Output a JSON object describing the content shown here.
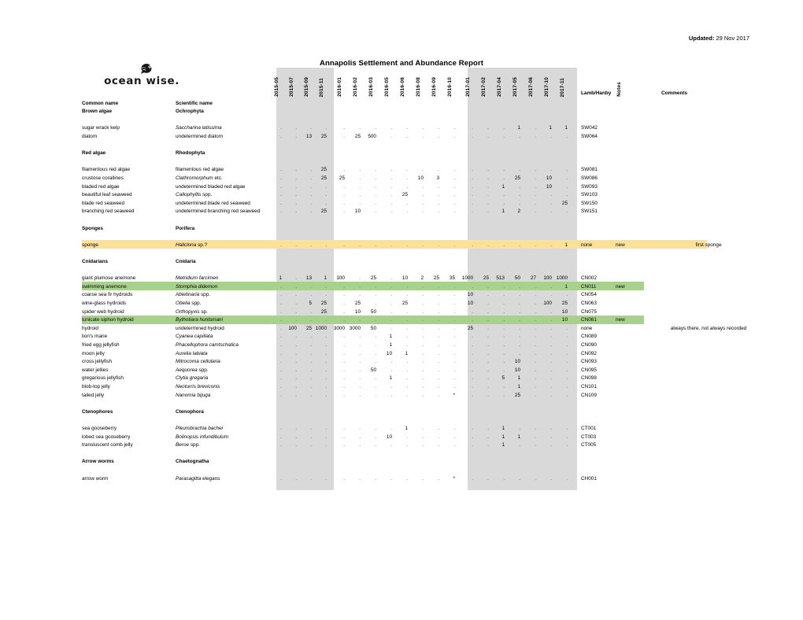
{
  "meta": {
    "updated_label": "Updated:",
    "updated_value": "29 Nov 2017",
    "title": "Annapolis Settlement and Abundance Report",
    "logo_text": "ocean wise.",
    "logo_icon": "orca-globe-icon"
  },
  "columns": {
    "common_name_header": "Common name",
    "scientific_name_header": "Scientific name",
    "periods": [
      "2015-05",
      "2015-07",
      "2015-09",
      "2015-11",
      "2016-01",
      "2016-02",
      "2016-03",
      "2016-05",
      "2016-06",
      "2016-08",
      "2016-09",
      "2016-10",
      "2017-01",
      "2017-02",
      "2017-04",
      "2017-05",
      "2017-06",
      "2017-10",
      "2017-11"
    ],
    "lamb_hanby_header": "Lamb/Hanby",
    "notes_header": "Notes",
    "comments_header": "Comments"
  },
  "colors": {
    "band_gray": "#d9d9d9",
    "highlight_yellow": "#fce197",
    "highlight_green": "#a9d18e",
    "text": "#000000"
  },
  "rows": [
    {
      "type": "group",
      "common": "Brown algae",
      "sci": "Ochrophyta",
      "sci_italic": false,
      "values": [],
      "code": "",
      "note": "",
      "comment": ""
    },
    {
      "type": "spacer"
    },
    {
      "type": "data",
      "common": "sugar wrack kelp",
      "sci": "Saccharina latissima",
      "sci_italic": true,
      "values": [
        ".",
        ".",
        ".",
        ".",
        ".",
        ".",
        ".",
        ".",
        ".",
        ".",
        ".",
        ".",
        ".",
        ".",
        ".",
        "1",
        ".",
        "1",
        "1"
      ],
      "code": "SW042",
      "note": "",
      "comment": ""
    },
    {
      "type": "data",
      "common": "diatom",
      "sci": "undetermined diatom",
      "sci_italic": false,
      "values": [
        ".",
        ".",
        "13",
        "25",
        ".",
        "25",
        "500",
        ".",
        ".",
        ".",
        ".",
        ".",
        ".",
        ".",
        ".",
        ".",
        ".",
        ".",
        "."
      ],
      "code": "SW064",
      "note": "",
      "comment": ""
    },
    {
      "type": "spacer"
    },
    {
      "type": "group",
      "common": "Red algae",
      "sci": "Rhodophyta",
      "sci_italic": false,
      "values": [],
      "code": "",
      "note": "",
      "comment": ""
    },
    {
      "type": "spacer"
    },
    {
      "type": "data",
      "common": "filamentous red algae",
      "sci": "filamentous red algae",
      "sci_italic": false,
      "values": [
        ".",
        ".",
        ".",
        "25",
        ".",
        ".",
        ".",
        ".",
        ".",
        ".",
        ".",
        ".",
        ".",
        ".",
        ".",
        ".",
        ".",
        ".",
        "."
      ],
      "code": "SW081",
      "note": "",
      "comment": ""
    },
    {
      "type": "data",
      "common": "crustose corallines",
      "sci": "Clathromorphum etc.",
      "sci_italic": true,
      "values": [
        ".",
        ".",
        ".",
        "25",
        "25",
        ".",
        ".",
        ".",
        ".",
        "10",
        "3",
        ".",
        ".",
        ".",
        ".",
        "25",
        ".",
        "10",
        "."
      ],
      "code": "SW086",
      "note": "",
      "comment": ""
    },
    {
      "type": "data",
      "common": "bladed red algae",
      "sci": "undetermined bladed red algae",
      "sci_italic": false,
      "values": [
        ".",
        ".",
        ".",
        ".",
        ".",
        ".",
        ".",
        ".",
        ".",
        ".",
        ".",
        ".",
        ".",
        ".",
        "1",
        ".",
        ".",
        "10",
        "."
      ],
      "code": "SW093",
      "note": "",
      "comment": ""
    },
    {
      "type": "data",
      "common": "beautiful leaf seaweed",
      "sci": "Callophyllis spp.",
      "sci_italic": true,
      "values": [
        ".",
        ".",
        ".",
        ".",
        ".",
        ".",
        ".",
        ".",
        "25",
        ".",
        ".",
        ".",
        ".",
        ".",
        ".",
        ".",
        ".",
        ".",
        "."
      ],
      "code": "SW103",
      "note": "",
      "comment": ""
    },
    {
      "type": "data",
      "common": "blade red seaweed",
      "sci": "undetermined blade red seaweed",
      "sci_italic": false,
      "values": [
        ".",
        ".",
        ".",
        ".",
        ".",
        ".",
        ".",
        ".",
        ".",
        ".",
        ".",
        ".",
        ".",
        ".",
        ".",
        ".",
        ".",
        ".",
        "25"
      ],
      "code": "SW150",
      "note": "",
      "comment": ""
    },
    {
      "type": "data",
      "common": "branching red seaweed",
      "sci": "undetermined branching red seaweed",
      "sci_italic": false,
      "values": [
        ".",
        ".",
        ".",
        "25",
        ".",
        "10",
        ".",
        ".",
        ".",
        ".",
        ".",
        ".",
        ".",
        ".",
        "1",
        "2",
        ".",
        ".",
        "."
      ],
      "code": "SW151",
      "note": "",
      "comment": ""
    },
    {
      "type": "spacer"
    },
    {
      "type": "group",
      "common": "Sponges",
      "sci": "Porifera",
      "sci_italic": false,
      "values": [],
      "code": "",
      "note": "",
      "comment": ""
    },
    {
      "type": "spacer"
    },
    {
      "type": "data",
      "common": "sponge",
      "sci": "Haliclona sp.?",
      "sci_italic": true,
      "values": [
        ".",
        ".",
        ".",
        ".",
        ".",
        ".",
        ".",
        ".",
        ".",
        ".",
        ".",
        ".",
        ".",
        ".",
        ".",
        ".",
        ".",
        ".",
        "1"
      ],
      "code": "none",
      "note": "new",
      "comment": "first sponge",
      "highlight": "yellow",
      "highlight_width": "full"
    },
    {
      "type": "spacer"
    },
    {
      "type": "group",
      "common": "Cnidarians",
      "sci": "Cnidaria",
      "sci_italic": false,
      "values": [],
      "code": "",
      "note": "",
      "comment": ""
    },
    {
      "type": "spacer"
    },
    {
      "type": "data",
      "common": "giant plumose anemone",
      "sci": "Metridium farcimen",
      "sci_italic": true,
      "values": [
        "1",
        ".",
        "13",
        "1",
        "100",
        ".",
        "25",
        ".",
        "10",
        "2",
        "25",
        "35",
        "1000",
        "25",
        "513",
        "50",
        "27",
        "100",
        "1000"
      ],
      "code": "CN002",
      "note": "",
      "comment": ""
    },
    {
      "type": "data",
      "common": "swimming anemone",
      "sci": "Stomphia didemon",
      "sci_italic": true,
      "values": [
        ".",
        ".",
        ".",
        ".",
        ".",
        ".",
        ".",
        ".",
        ".",
        ".",
        ".",
        ".",
        ".",
        ".",
        ".",
        ".",
        ".",
        ".",
        "1"
      ],
      "code": "CN011",
      "note": "new",
      "comment": "",
      "highlight": "green",
      "highlight_width": "notes"
    },
    {
      "type": "data",
      "common": "coarse sea fir hydroids",
      "sci": "Abietinaria spp.",
      "sci_italic": true,
      "values": [
        ".",
        ".",
        ".",
        ".",
        ".",
        ".",
        ".",
        ".",
        ".",
        ".",
        ".",
        ".",
        "10",
        ".",
        ".",
        ".",
        ".",
        ".",
        "."
      ],
      "code": "CN054",
      "note": "",
      "comment": ""
    },
    {
      "type": "data",
      "common": "wine-glass hydroids",
      "sci": "Obelia spp.",
      "sci_italic": true,
      "values": [
        ".",
        ".",
        "5",
        "25",
        ".",
        "25",
        ".",
        ".",
        "25",
        ".",
        ".",
        ".",
        "10",
        ".",
        ".",
        ".",
        ".",
        "100",
        "25"
      ],
      "code": "CN063",
      "note": "",
      "comment": ""
    },
    {
      "type": "data",
      "common": "spider web hydroid",
      "sci": "Orthopyxis sp.",
      "sci_italic": true,
      "values": [
        ".",
        ".",
        ".",
        "25",
        ".",
        "10",
        "50",
        ".",
        ".",
        ".",
        ".",
        ".",
        ".",
        ".",
        ".",
        ".",
        ".",
        ".",
        "10"
      ],
      "code": "CN075",
      "note": "",
      "comment": ""
    },
    {
      "type": "data",
      "common": "tunicate siphon hydroid",
      "sci": "Bythotiara huntsmani",
      "sci_italic": true,
      "values": [
        ".",
        ".",
        ".",
        ".",
        ".",
        ".",
        ".",
        ".",
        ".",
        ".",
        ".",
        ".",
        ".",
        ".",
        ".",
        ".",
        ".",
        ".",
        "10"
      ],
      "code": "CN081",
      "note": "new",
      "comment": "",
      "highlight": "green",
      "highlight_width": "notes"
    },
    {
      "type": "data",
      "common": "hydroid",
      "sci": "undetermined hydroid",
      "sci_italic": false,
      "values": [
        ".",
        "100",
        "25",
        "1000",
        "3000",
        "3000",
        "50",
        ".",
        ".",
        ".",
        ".",
        ".",
        "25",
        ".",
        ".",
        ".",
        ".",
        ".",
        "."
      ],
      "code": "none",
      "note": "",
      "comment": "always there, not always recorded"
    },
    {
      "type": "data",
      "common": "lion's mane",
      "sci": "Cyanea capillata",
      "sci_italic": true,
      "values": [
        ".",
        ".",
        ".",
        ".",
        ".",
        ".",
        ".",
        "1",
        ".",
        ".",
        ".",
        ".",
        ".",
        ".",
        ".",
        ".",
        ".",
        ".",
        "."
      ],
      "code": "CN089",
      "note": "",
      "comment": ""
    },
    {
      "type": "data",
      "common": "fried egg jellyfish",
      "sci": "Phacellophora camtschatica",
      "sci_italic": true,
      "values": [
        ".",
        ".",
        ".",
        ".",
        ".",
        ".",
        ".",
        "1",
        ".",
        ".",
        ".",
        ".",
        ".",
        ".",
        ".",
        ".",
        ".",
        ".",
        "."
      ],
      "code": "CN090",
      "note": "",
      "comment": ""
    },
    {
      "type": "data",
      "common": "moon jelly",
      "sci": "Aurelia labiata",
      "sci_italic": true,
      "values": [
        ".",
        ".",
        ".",
        ".",
        ".",
        ".",
        ".",
        "10",
        "1",
        ".",
        ".",
        ".",
        ".",
        ".",
        ".",
        ".",
        ".",
        ".",
        "."
      ],
      "code": "CN092",
      "note": "",
      "comment": ""
    },
    {
      "type": "data",
      "common": "cross jellyfish",
      "sci": "Mitrocoma cellularia",
      "sci_italic": true,
      "values": [
        ".",
        ".",
        ".",
        ".",
        ".",
        ".",
        ".",
        ".",
        ".",
        ".",
        ".",
        ".",
        ".",
        ".",
        ".",
        "10",
        ".",
        ".",
        "."
      ],
      "code": "CN093",
      "note": "",
      "comment": ""
    },
    {
      "type": "data",
      "common": "water jellies",
      "sci": "Aequorea spp.",
      "sci_italic": true,
      "values": [
        ".",
        ".",
        ".",
        ".",
        ".",
        ".",
        "50",
        ".",
        ".",
        ".",
        ".",
        ".",
        ".",
        ".",
        ".",
        "10",
        ".",
        ".",
        "."
      ],
      "code": "CN095",
      "note": "",
      "comment": ""
    },
    {
      "type": "data",
      "common": "gregarious jellyfish",
      "sci": "Clytia gregaria",
      "sci_italic": true,
      "values": [
        ".",
        ".",
        ".",
        ".",
        ".",
        ".",
        ".",
        "1",
        ".",
        ".",
        ".",
        ".",
        ".",
        ".",
        "5",
        "1",
        ".",
        ".",
        "."
      ],
      "code": "CN098",
      "note": "",
      "comment": ""
    },
    {
      "type": "data",
      "common": "blob-top jelly",
      "sci": "Neoturris breviconis",
      "sci_italic": true,
      "values": [
        ".",
        ".",
        ".",
        ".",
        ".",
        ".",
        ".",
        ".",
        ".",
        ".",
        ".",
        ".",
        ".",
        ".",
        ".",
        "1",
        ".",
        ".",
        "."
      ],
      "code": "CN101",
      "note": "",
      "comment": ""
    },
    {
      "type": "data",
      "common": "tailed jelly",
      "sci": "Nanomia bijuga",
      "sci_italic": true,
      "values": [
        ".",
        ".",
        ".",
        ".",
        ".",
        ".",
        ".",
        ".",
        ".",
        ".",
        ".",
        "*",
        ".",
        ".",
        ".",
        "25",
        ".",
        ".",
        "."
      ],
      "code": "CN109",
      "note": "",
      "comment": ""
    },
    {
      "type": "spacer"
    },
    {
      "type": "group",
      "common": "Ctenophores",
      "sci": "Ctenophora",
      "sci_italic": false,
      "values": [],
      "code": "",
      "note": "",
      "comment": ""
    },
    {
      "type": "spacer"
    },
    {
      "type": "data",
      "common": "sea gooseberry",
      "sci": "Pleurobrachia bachei",
      "sci_italic": true,
      "values": [
        ".",
        ".",
        ".",
        ".",
        ".",
        ".",
        ".",
        ".",
        "1",
        ".",
        ".",
        ".",
        ".",
        ".",
        "1",
        ".",
        ".",
        ".",
        "."
      ],
      "code": "CT001",
      "note": "",
      "comment": ""
    },
    {
      "type": "data",
      "common": "lobed sea gooseberry",
      "sci": "Bolinopsis infundibulum",
      "sci_italic": true,
      "values": [
        ".",
        ".",
        ".",
        ".",
        ".",
        ".",
        ".",
        "10",
        ".",
        ".",
        ".",
        ".",
        ".",
        ".",
        "1",
        "1",
        ".",
        ".",
        "."
      ],
      "code": "CT003",
      "note": "",
      "comment": ""
    },
    {
      "type": "data",
      "common": "transluscent comb jelly",
      "sci": "Beroe spp.",
      "sci_italic": true,
      "values": [
        ".",
        ".",
        ".",
        ".",
        ".",
        ".",
        ".",
        ".",
        ".",
        ".",
        ".",
        ".",
        ".",
        ".",
        "1",
        ".",
        ".",
        ".",
        "."
      ],
      "code": "CT005",
      "note": "",
      "comment": ""
    },
    {
      "type": "spacer"
    },
    {
      "type": "group",
      "common": "Arrow worms",
      "sci": "Chaetognatha",
      "sci_italic": false,
      "values": [],
      "code": "",
      "note": "",
      "comment": ""
    },
    {
      "type": "spacer"
    },
    {
      "type": "data",
      "common": "arrow worm",
      "sci": "Parasagitta elegans",
      "sci_italic": true,
      "values": [
        ".",
        ".",
        ".",
        ".",
        ".",
        ".",
        ".",
        ".",
        ".",
        ".",
        ".",
        "*",
        ".",
        ".",
        ".",
        ".",
        ".",
        ".",
        "."
      ],
      "code": "CH001",
      "note": "",
      "comment": ""
    }
  ]
}
